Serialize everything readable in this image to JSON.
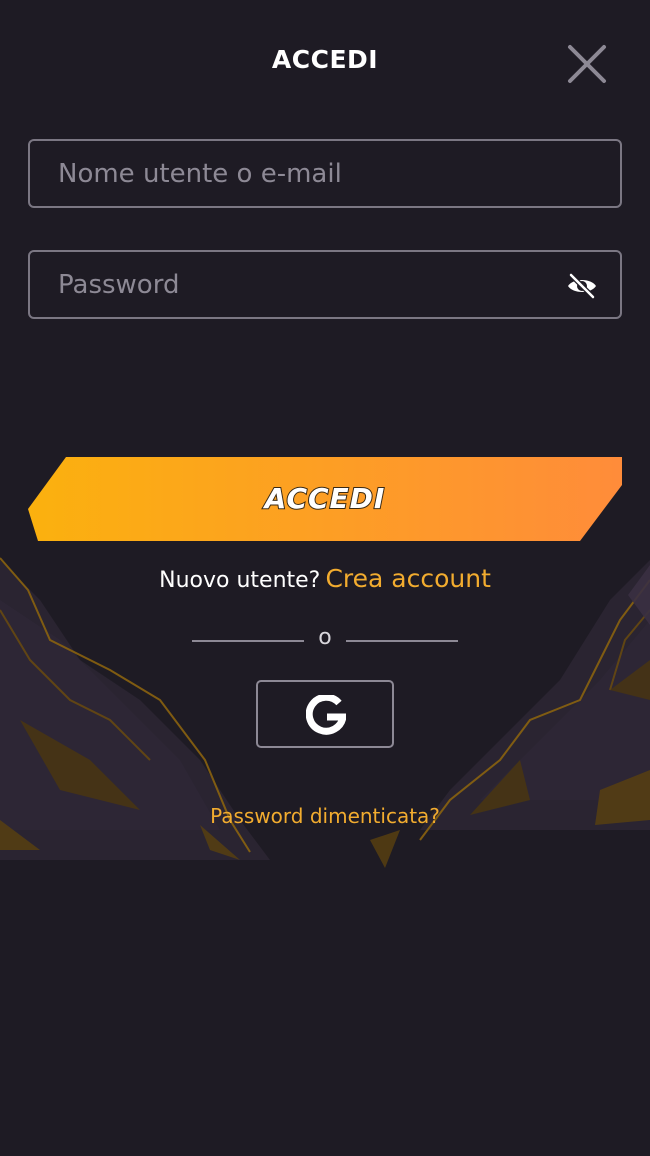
{
  "header": {
    "title": "ACCEDI",
    "close_icon": "close-icon"
  },
  "form": {
    "username": {
      "value": "",
      "placeholder": "Nome utente o e-mail"
    },
    "password": {
      "value": "",
      "placeholder": "Password",
      "visibility_icon": "eye-off-icon"
    },
    "submit_label": "ACCEDI"
  },
  "signup": {
    "prompt": "Nuovo utente?",
    "link_label": "Crea account"
  },
  "divider": {
    "label": "o"
  },
  "social": {
    "google_icon": "google-icon"
  },
  "forgot_password": "Password dimenticata?",
  "colors": {
    "background": "#1e1b24",
    "accent": "#f2ac2f",
    "button_gradient_start": "#fbb10e",
    "button_gradient_end": "#ff8c3a",
    "field_border": "#7b7783"
  }
}
